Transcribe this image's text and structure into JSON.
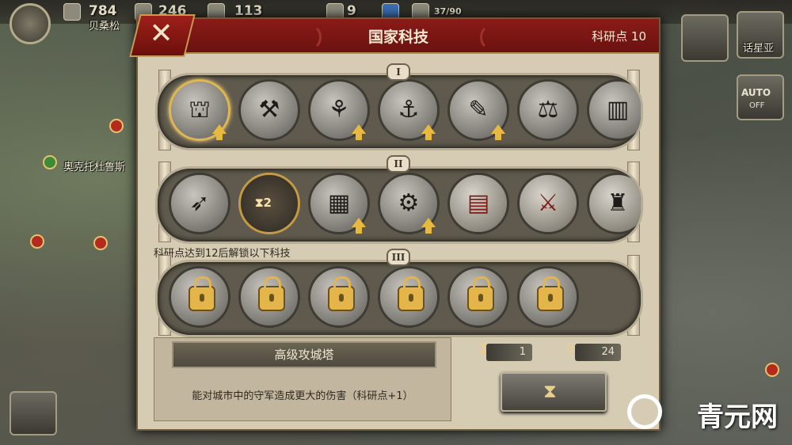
{
  "hud": {
    "res1": "784",
    "res2": "246",
    "res3": "113",
    "res4": "9",
    "pop": "37/90"
  },
  "map": {
    "label_top": "贝桑松",
    "label_left": "奥克托杜鲁斯",
    "label_right_top": "话星亚",
    "auto_label": "AUTO",
    "off_label": "OFF"
  },
  "dialog": {
    "title": "国家科技",
    "points": "科研点 10",
    "close_glyph": "✕"
  },
  "tiers": [
    {
      "numeral": "I",
      "nodes": [
        {
          "icon": "siege-tower-icon",
          "selected": true,
          "upgrade": true
        },
        {
          "icon": "workshop-icon",
          "upgrade": false
        },
        {
          "icon": "wheat-icon",
          "upgrade": true
        },
        {
          "icon": "grappling-hook-icon",
          "upgrade": true
        },
        {
          "icon": "scroll-icon",
          "upgrade": true
        },
        {
          "icon": "scales-icon",
          "upgrade": false
        },
        {
          "icon": "wall-gate-icon",
          "upgrade": false
        }
      ]
    },
    {
      "numeral": "II",
      "nodes": [
        {
          "icon": "ballista-icon",
          "upgrade": false
        },
        {
          "icon": "hourglass-gear-icon",
          "special": true,
          "label": "2"
        },
        {
          "icon": "brick-wall-icon",
          "upgrade": true
        },
        {
          "icon": "hammer-gear-icon",
          "upgrade": true
        },
        {
          "icon": "chainmail-icon",
          "upgrade": false
        },
        {
          "icon": "fasces-icon",
          "upgrade": false
        },
        {
          "icon": "eagle-standard-icon",
          "upgrade": false
        }
      ]
    },
    {
      "numeral": "III",
      "nodes": [
        {
          "icon": "catapult-locked-icon",
          "locked": true
        },
        {
          "icon": "soldier-locked-icon",
          "locked": true
        },
        {
          "icon": "temple-locked-icon",
          "locked": true
        },
        {
          "icon": "battle-locked-icon",
          "locked": true
        },
        {
          "icon": "city-locked-icon",
          "locked": true
        },
        {
          "icon": "map-locked-icon",
          "locked": true
        }
      ]
    }
  ],
  "unlock_notice": "科研点达到12后解锁以下科技",
  "detail": {
    "title": "高级攻城塔",
    "description": "能对城市中的守军造成更大的伤害（科研点+1）"
  },
  "costs": {
    "time": "1",
    "scroll": "24"
  },
  "watermark": "青元网"
}
